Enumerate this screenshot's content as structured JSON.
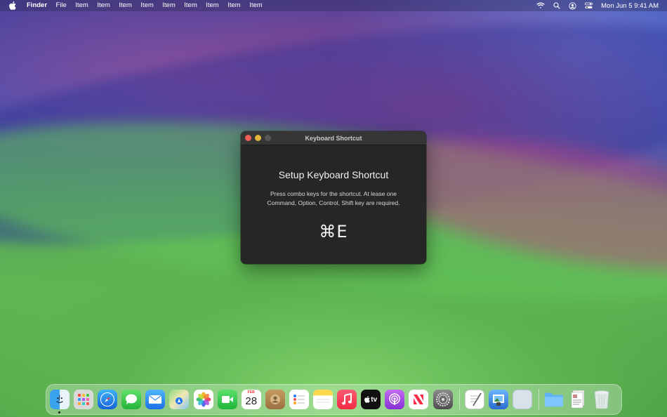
{
  "menubar": {
    "app_name": "Finder",
    "menus": [
      "File",
      "Item",
      "Item",
      "Item",
      "Item",
      "Item",
      "Item",
      "Item",
      "Item",
      "Item"
    ],
    "clock": "Mon Jun 5  9:41 AM",
    "status_icons": [
      "wifi-icon",
      "spotlight-search-icon",
      "user-account-icon",
      "control-center-icon"
    ]
  },
  "window": {
    "title": "Keyboard Shortcut",
    "heading": "Setup Keyboard Shortcut",
    "description_line1": "Press combo keys for the shortcut. At lease one",
    "description_line2": "Command, Option, Control, Shift key are required.",
    "shortcut": "⌘E"
  },
  "dock": {
    "calendar_month": "FEB",
    "calendar_day": "28",
    "apple_tv_label": "tv",
    "apps": [
      "finder",
      "launchpad",
      "safari",
      "messages",
      "mail",
      "maps",
      "photos",
      "facetime",
      "calendar",
      "contacts",
      "reminders",
      "notes",
      "music",
      "tv",
      "podcasts",
      "news",
      "system-settings",
      "textedit",
      "preview",
      "blank-app",
      "downloads-folder",
      "document-stack",
      "trash"
    ]
  }
}
